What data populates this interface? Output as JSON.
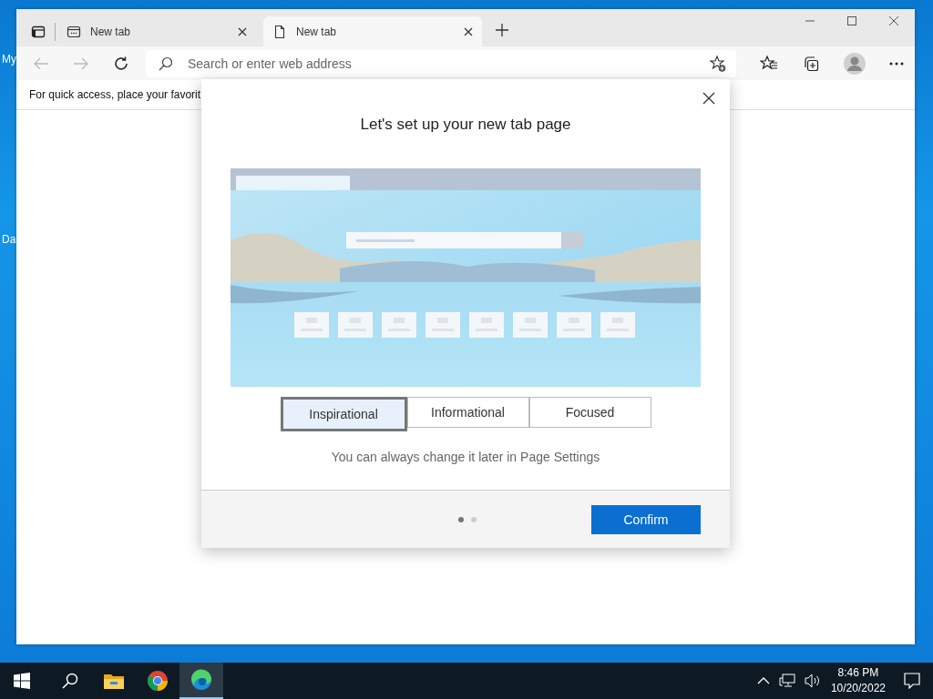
{
  "desktop": {
    "icon_labels": [
      "My",
      "Da"
    ]
  },
  "browser": {
    "tabs": [
      {
        "title": "New tab",
        "selected": false
      },
      {
        "title": "New tab",
        "selected": true
      }
    ],
    "address_bar": {
      "placeholder": "Search or enter web address"
    },
    "favorites_bar": {
      "text": "For quick access, place your favorit"
    }
  },
  "dialog": {
    "title": "Let's set up your new tab page",
    "layouts": [
      {
        "label": "Inspirational",
        "selected": true
      },
      {
        "label": "Informational",
        "selected": false
      },
      {
        "label": "Focused",
        "selected": false
      }
    ],
    "note": "You can always change it later in Page Settings",
    "pages": [
      {
        "selected": true
      },
      {
        "selected": false
      }
    ],
    "confirm": "Confirm"
  },
  "taskbar": {
    "apps": [
      {
        "kind": "files",
        "active": false
      },
      {
        "kind": "chrome",
        "active": false
      },
      {
        "kind": "edge",
        "active": true
      }
    ],
    "time": "8:46 PM",
    "date": "10/20/2022"
  }
}
